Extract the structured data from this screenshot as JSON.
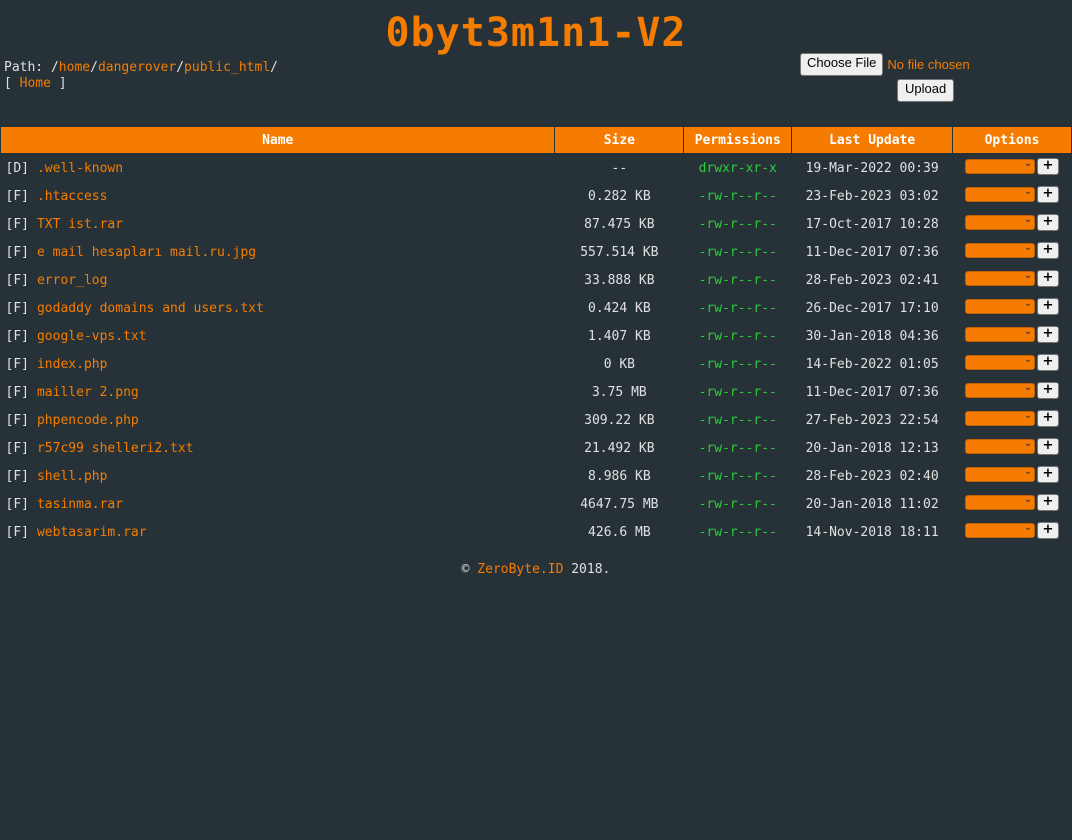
{
  "title": "0byt3m1n1-V2",
  "path": {
    "label": "Path: ",
    "segments": [
      "home",
      "dangerover",
      "public_html"
    ]
  },
  "home_link": "Home",
  "upload": {
    "choose_label": "Choose File",
    "no_file": "No file chosen",
    "upload_label": "Upload"
  },
  "table": {
    "headers": [
      "Name",
      "Size",
      "Permissions",
      "Last Update",
      "Options"
    ],
    "rows": [
      {
        "type": "[D]",
        "name": ".well-known",
        "size": "--",
        "perm": "drwxr-xr-x",
        "date": "19-Mar-2022 00:39"
      },
      {
        "type": "[F]",
        "name": ".htaccess",
        "size": "0.282 KB",
        "perm": "-rw-r--r--",
        "date": "23-Feb-2023 03:02"
      },
      {
        "type": "[F]",
        "name": "TXT ist.rar",
        "size": "87.475 KB",
        "perm": "-rw-r--r--",
        "date": "17-Oct-2017 10:28"
      },
      {
        "type": "[F]",
        "name": "e mail hesapları mail.ru.jpg",
        "size": "557.514 KB",
        "perm": "-rw-r--r--",
        "date": "11-Dec-2017 07:36"
      },
      {
        "type": "[F]",
        "name": "error_log",
        "size": "33.888 KB",
        "perm": "-rw-r--r--",
        "date": "28-Feb-2023 02:41"
      },
      {
        "type": "[F]",
        "name": "godaddy domains and users.txt",
        "size": "0.424 KB",
        "perm": "-rw-r--r--",
        "date": "26-Dec-2017 17:10"
      },
      {
        "type": "[F]",
        "name": "google-vps.txt",
        "size": "1.407 KB",
        "perm": "-rw-r--r--",
        "date": "30-Jan-2018 04:36"
      },
      {
        "type": "[F]",
        "name": "index.php",
        "size": "0 KB",
        "perm": "-rw-r--r--",
        "date": "14-Feb-2022 01:05"
      },
      {
        "type": "[F]",
        "name": "mailler 2.png",
        "size": "3.75 MB",
        "perm": "-rw-r--r--",
        "date": "11-Dec-2017 07:36"
      },
      {
        "type": "[F]",
        "name": "phpencode.php",
        "size": "309.22 KB",
        "perm": "-rw-r--r--",
        "date": "27-Feb-2023 22:54"
      },
      {
        "type": "[F]",
        "name": "r57c99 shelleri2.txt",
        "size": "21.492 KB",
        "perm": "-rw-r--r--",
        "date": "20-Jan-2018 12:13"
      },
      {
        "type": "[F]",
        "name": "shell.php",
        "size": "8.986 KB",
        "perm": "-rw-r--r--",
        "date": "28-Feb-2023 02:40"
      },
      {
        "type": "[F]",
        "name": "tasinma.rar",
        "size": "4647.75 MB",
        "perm": "-rw-r--r--",
        "date": "20-Jan-2018 11:02"
      },
      {
        "type": "[F]",
        "name": "webtasarim.rar",
        "size": "426.6 MB",
        "perm": "-rw-r--r--",
        "date": "14-Nov-2018 18:11"
      }
    ],
    "plus_label": "+"
  },
  "footer": {
    "copy": "© ",
    "brand": "ZeroByte.ID",
    "year": " 2018."
  },
  "colors": {
    "background": "#263238",
    "accent": "#f57c00",
    "perm_green": "#2ecc40"
  }
}
